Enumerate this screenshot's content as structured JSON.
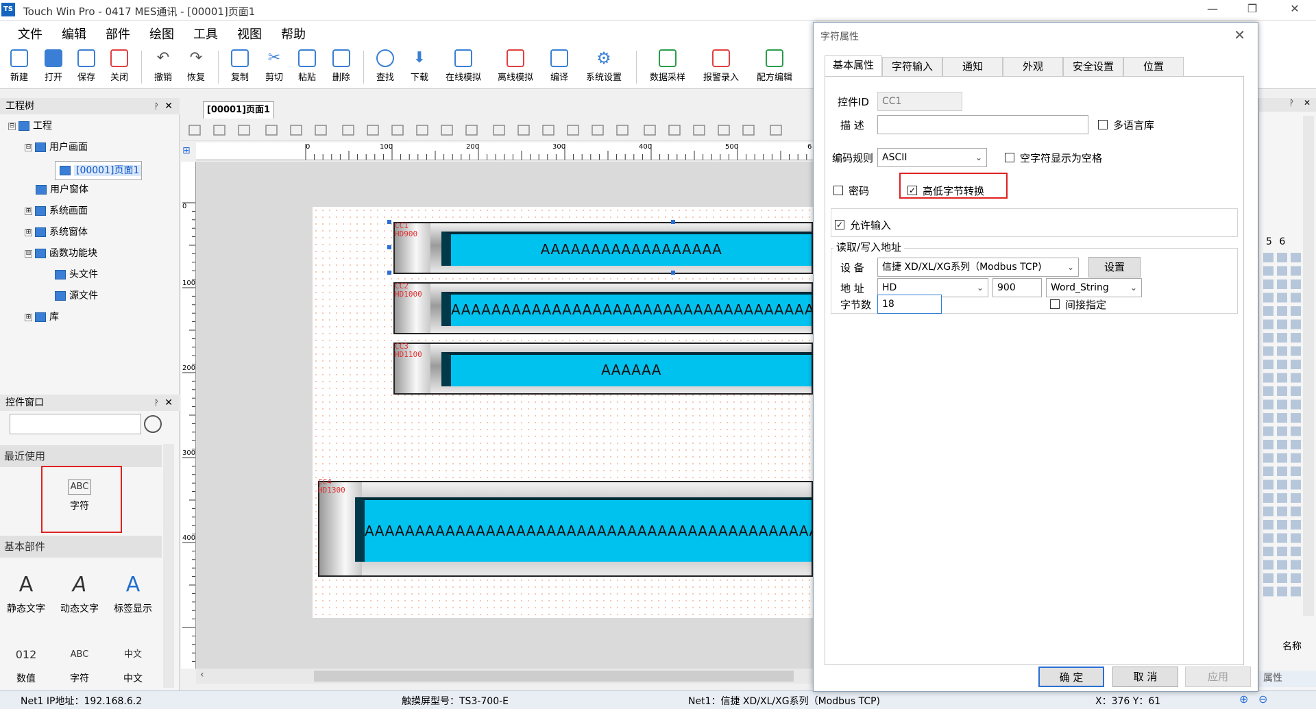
{
  "window": {
    "logo": "TS",
    "title": "Touch Win Pro - 0417 MES通讯 - [00001]页面1",
    "min": "—",
    "restore": "❐",
    "close": "✕"
  },
  "menu": [
    "文件",
    "编辑",
    "部件",
    "绘图",
    "工具",
    "视图",
    "帮助"
  ],
  "toolbar": [
    "新建",
    "打开",
    "保存",
    "关闭",
    "撤销",
    "恢复",
    "复制",
    "剪切",
    "粘贴",
    "删除",
    "查找",
    "下载",
    "在线模拟",
    "离线模拟",
    "编译",
    "系统设置",
    "数据采样",
    "报警录入",
    "配方编辑"
  ],
  "tree": {
    "title": "工程树",
    "pin": "ᚹ",
    "close": "✕",
    "nodes": [
      {
        "label": "工程",
        "exp": "⊟"
      },
      {
        "label": "用户画面",
        "exp": "⊟"
      },
      {
        "label": "[00001]页面1",
        "exp": ""
      },
      {
        "label": "用户窗体",
        "exp": ""
      },
      {
        "label": "系统画面",
        "exp": "⊞"
      },
      {
        "label": "系统窗体",
        "exp": "⊞"
      },
      {
        "label": "函数功能块",
        "exp": "⊟"
      },
      {
        "label": "头文件",
        "exp": ""
      },
      {
        "label": "源文件",
        "exp": ""
      },
      {
        "label": "库",
        "exp": "⊞"
      }
    ]
  },
  "controls": {
    "title": "控件窗口",
    "pin": "ᚹ",
    "close": "✕",
    "search_placeholder": "",
    "recent_title": "最近使用",
    "recent": [
      {
        "icon": "ABC",
        "label": "字符"
      }
    ],
    "basic_title": "基本部件",
    "basic": [
      {
        "icon": "A",
        "label": "静态文字"
      },
      {
        "icon": "A",
        "label": "动态文字"
      },
      {
        "icon": "A",
        "label": "标签显示"
      },
      {
        "icon": "012",
        "label": "数值"
      },
      {
        "icon": "ABC",
        "label": "字符"
      },
      {
        "icon": "中文",
        "label": "中文"
      }
    ]
  },
  "editor": {
    "tab": "[00001]页面1",
    "ruler_x": [
      "0",
      "100",
      "200",
      "300",
      "400",
      "500",
      "6"
    ],
    "ruler_y": [
      "0",
      "100",
      "200",
      "300",
      "400"
    ],
    "items": [
      {
        "id": "CC1",
        "addr": "HD900",
        "text": "AAAAAAAAAAAAAAAAAA"
      },
      {
        "id": "CC2",
        "addr": "HD1000",
        "text": "AAAAAAAAAAAAAAAAAAAAAAAAAAAAAAAAAAAAAAAAA"
      },
      {
        "id": "CC3",
        "addr": "HD1100",
        "text": "AAAAAA"
      },
      {
        "id": "CC4",
        "addr": "HD1300",
        "text": "AAAAAAAAAAAAAAAAAAAAAAAAAAAAAAAAAAAAAAAAAAAAAAAAAAAAAA"
      }
    ]
  },
  "right_panel": {
    "nums": "5   6",
    "name_label": "名称",
    "prop_tab": "属性"
  },
  "status": {
    "net": "Net1  IP地址：192.168.6.2",
    "model": "触摸屏型号：TS3-700-E",
    "device": "Net1：信捷 XD/XL/XG系列（Modbus TCP)",
    "coords": "X：376   Y：61"
  },
  "dialog": {
    "title": "字符属性",
    "close": "✕",
    "tabs": [
      "基本属性",
      "字符输入",
      "通知",
      "外观",
      "安全设置",
      "位置"
    ],
    "id_label": "控件ID",
    "id_value": "CC1",
    "desc_label": "描  述",
    "desc_value": "",
    "multilang": "多语言库",
    "encoding_label": "编码规则",
    "encoding_value": "ASCII",
    "null_as_space": "空字符显示为空格",
    "password": "密码",
    "byte_swap": "高低字节转换",
    "byte_swap_checked": true,
    "allow_input": "允许输入",
    "allow_input_checked": true,
    "rw_title": "读取/写入地址",
    "device_label": "设  备",
    "device_value": "信捷 XD/XL/XG系列（Modbus TCP)",
    "setup_btn": "设置",
    "addr_label": "地  址",
    "addr_type": "HD",
    "addr_num": "900",
    "addr_format": "Word_String",
    "bytes_label": "字节数",
    "bytes_value": "18",
    "indirect": "间接指定",
    "ok": "确 定",
    "cancel": "取 消",
    "apply": "应用"
  }
}
